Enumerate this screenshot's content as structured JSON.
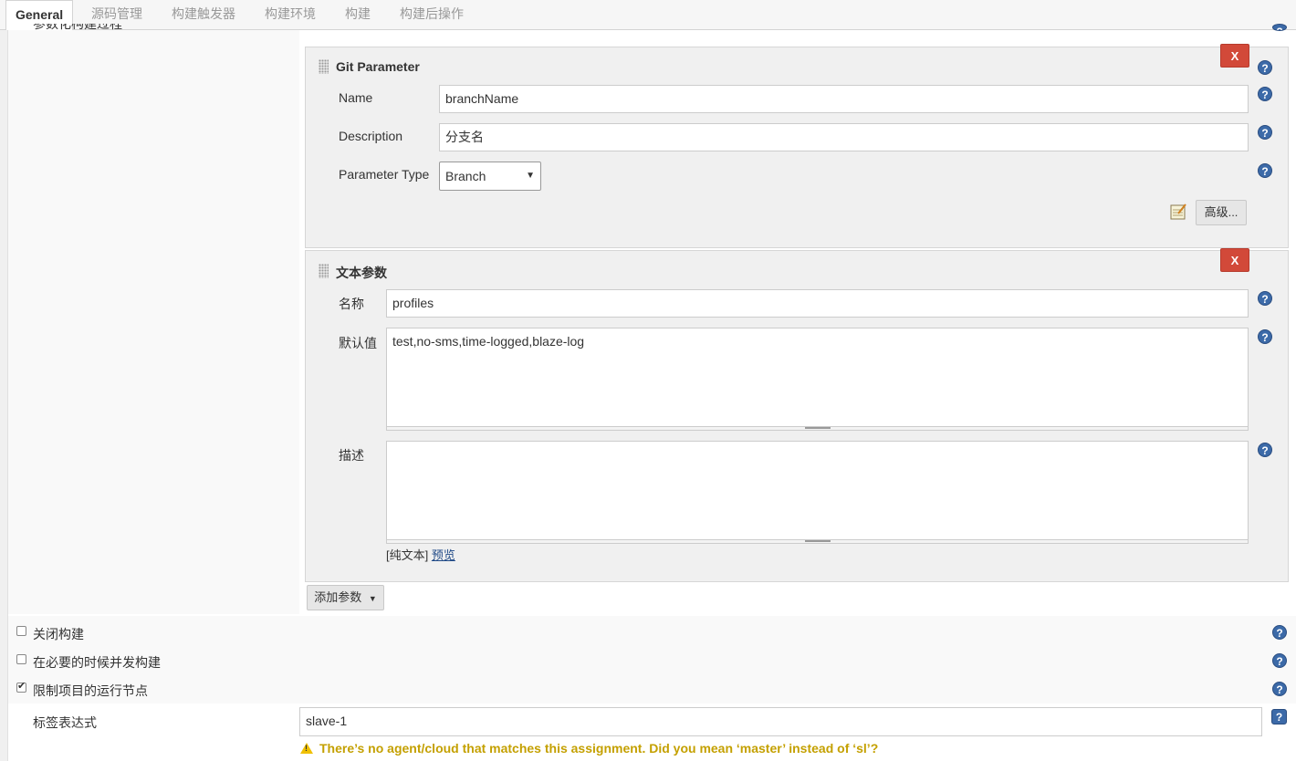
{
  "tabs": [
    "General",
    "源码管理",
    "构建触发器",
    "构建环境",
    "构建",
    "构建后操作"
  ],
  "top_cut_label": "参数化构建过程",
  "git_param": {
    "title": "Git Parameter",
    "delete_label": "X",
    "name_label": "Name",
    "name_value": "branchName",
    "desc_label": "Description",
    "desc_value": "分支名",
    "type_label": "Parameter Type",
    "type_value": "Branch",
    "advanced_label": "高级..."
  },
  "text_param": {
    "title": "文本参数",
    "delete_label": "X",
    "name_label": "名称",
    "name_value": "profiles",
    "default_label": "默认值",
    "default_value": "test,no-sms,time-logged,blaze-log",
    "desc_label": "描述",
    "desc_value": "",
    "plain_text": "[纯文本]",
    "preview_link": "预览"
  },
  "add_param_label": "添加参数",
  "options": [
    {
      "label": "关闭构建",
      "checked": false
    },
    {
      "label": "在必要的时候并发构建",
      "checked": false
    },
    {
      "label": "限制项目的运行节点",
      "checked": true
    }
  ],
  "label_expr": {
    "label": "标签表达式",
    "value": "slave-1",
    "warning": "There’s no agent/cloud that matches this assignment. Did you mean ‘master’ instead of ‘sl’?"
  },
  "help_glyph": "?",
  "colors": {
    "delete_red": "#d24939",
    "help_blue": "#3c6aa8",
    "warning_text": "#c4a000",
    "panel_bg": "#f0f0f0"
  }
}
